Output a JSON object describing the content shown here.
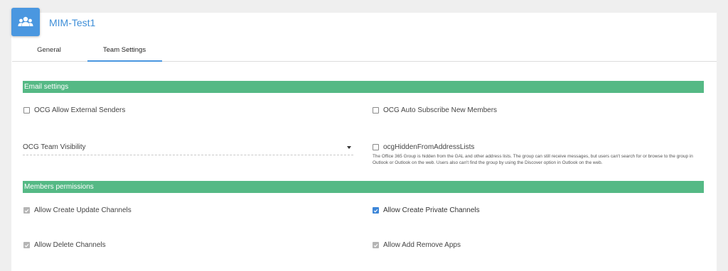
{
  "header": {
    "group_name": "MIM-Test1",
    "avatar_icon": "group-people-icon"
  },
  "tabs": [
    {
      "label": "General",
      "active": false
    },
    {
      "label": "Team Settings",
      "active": true
    }
  ],
  "email_settings": {
    "section_title": "Email settings",
    "allow_external_senders": {
      "label": "OCG Allow External Senders",
      "checked": false
    },
    "auto_subscribe": {
      "label": "OCG Auto Subscribe New Members",
      "checked": false
    },
    "team_visibility": {
      "label": "OCG Team Visibility"
    },
    "hidden_from_address_lists": {
      "label": "ocgHiddenFromAddressLists",
      "checked": false,
      "help": "The Office 365 Group is hidden from the GAL and other address lists. The group can still receive messages, but users can't search for or browse to the group in Outlook or Outlook on the web. Users also can't find the group by using the Discover option in Outlook on the web."
    }
  },
  "members_permissions": {
    "section_title": "Members permissions",
    "create_update_channels": {
      "label": "Allow Create Update Channels",
      "checked": true,
      "disabled": true
    },
    "create_private_channels": {
      "label": "Allow Create Private Channels",
      "checked": true,
      "disabled": false
    },
    "delete_channels": {
      "label": "Allow Delete Channels",
      "checked": true,
      "disabled": true
    },
    "add_remove_apps": {
      "label": "Allow Add Remove Apps",
      "checked": true,
      "disabled": true
    }
  },
  "colors": {
    "accent": "#4a97e0",
    "section_bar": "#55b985",
    "checkbox_blue": "#3d86d8"
  }
}
